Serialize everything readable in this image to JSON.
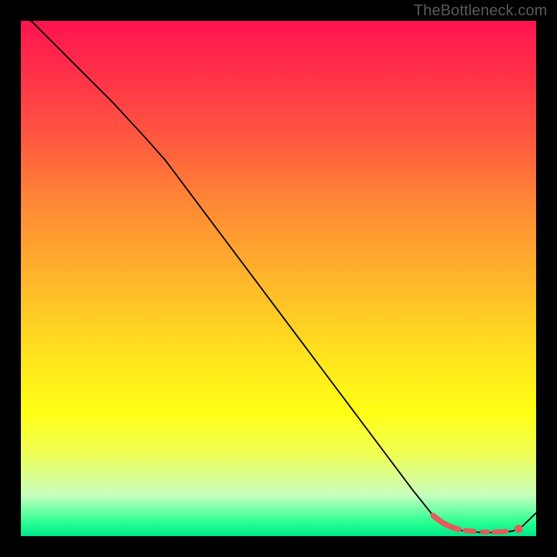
{
  "watermark": "TheBottleneck.com",
  "chart_data": {
    "type": "line",
    "title": "",
    "xlabel": "",
    "ylabel": "",
    "xlim": [
      0,
      100
    ],
    "ylim": [
      0,
      100
    ],
    "grid": false,
    "background_gradient": {
      "top": "#ff1450",
      "middle_upper": "#ff8a35",
      "middle": "#ffe01f",
      "middle_lower": "#ffff14",
      "bottom": "#00e88a"
    },
    "series": [
      {
        "name": "bottleneck-curve",
        "color": "#000000",
        "stroke_width": 2,
        "x": [
          0,
          6,
          12,
          18,
          24,
          28,
          34,
          40,
          46,
          52,
          58,
          64,
          70,
          76,
          80,
          82,
          84,
          86,
          88,
          90,
          92,
          94,
          95.5,
          97,
          100
        ],
        "y": [
          102,
          96,
          90,
          84,
          77.5,
          73,
          65,
          57,
          49,
          41,
          33,
          25,
          17,
          9,
          4,
          2.2,
          1.4,
          1.0,
          0.8,
          0.7,
          0.7,
          0.8,
          1.0,
          1.6,
          4.5
        ]
      }
    ],
    "markers": [
      {
        "name": "highlight-segment",
        "color": "#e55a5a",
        "stroke_width": 8,
        "x": [
          80,
          81,
          82,
          83,
          84,
          85
        ],
        "y": [
          4.0,
          3.2,
          2.5,
          2.0,
          1.6,
          1.3
        ]
      },
      {
        "name": "dash-a",
        "color": "#e55a5a",
        "stroke_width": 7,
        "x": [
          86.2,
          88.0
        ],
        "y": [
          1.1,
          0.9
        ]
      },
      {
        "name": "dash-b",
        "color": "#e55a5a",
        "stroke_width": 7,
        "x": [
          89.6,
          90.6
        ],
        "y": [
          0.8,
          0.8
        ]
      },
      {
        "name": "dash-c",
        "color": "#e55a5a",
        "stroke_width": 7,
        "x": [
          91.8,
          94.2
        ],
        "y": [
          0.8,
          0.9
        ]
      },
      {
        "name": "end-dot",
        "color": "#e55a5a",
        "type": "dot",
        "r": 6,
        "x": [
          96.6
        ],
        "y": [
          1.4
        ]
      }
    ]
  }
}
